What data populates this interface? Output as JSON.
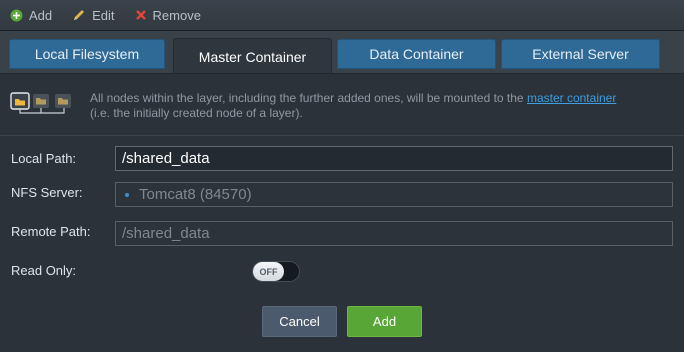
{
  "toolbar": {
    "add_label": "Add",
    "edit_label": "Edit",
    "remove_label": "Remove",
    "icons": [
      "plus-circle-icon",
      "pencil-icon",
      "x-icon"
    ]
  },
  "tabs": [
    {
      "label": "Local Filesystem",
      "active": false
    },
    {
      "label": "Master Container",
      "active": true
    },
    {
      "label": "Data Container",
      "active": false
    },
    {
      "label": "External Server",
      "active": false
    }
  ],
  "info": {
    "text_before": "All nodes within the layer, including the further added ones, will be mounted to the ",
    "link": "master container",
    "text_after": "(i.e. the initially created node of a layer)."
  },
  "form": {
    "local_path_label": "Local Path:",
    "local_path_value": "/shared_data",
    "nfs_server_label": "NFS Server:",
    "nfs_server_value": "Tomcat8 (84570)",
    "remote_path_label": "Remote Path:",
    "remote_path_value": "/shared_data",
    "read_only_label": "Read Only:",
    "read_only_toggle": "OFF"
  },
  "buttons": {
    "cancel_label": "Cancel",
    "add_label": "Add"
  },
  "colors": {
    "add_button": "#58a636",
    "tab_inactive": "#2f6a96",
    "link": "#3d9ee0"
  }
}
